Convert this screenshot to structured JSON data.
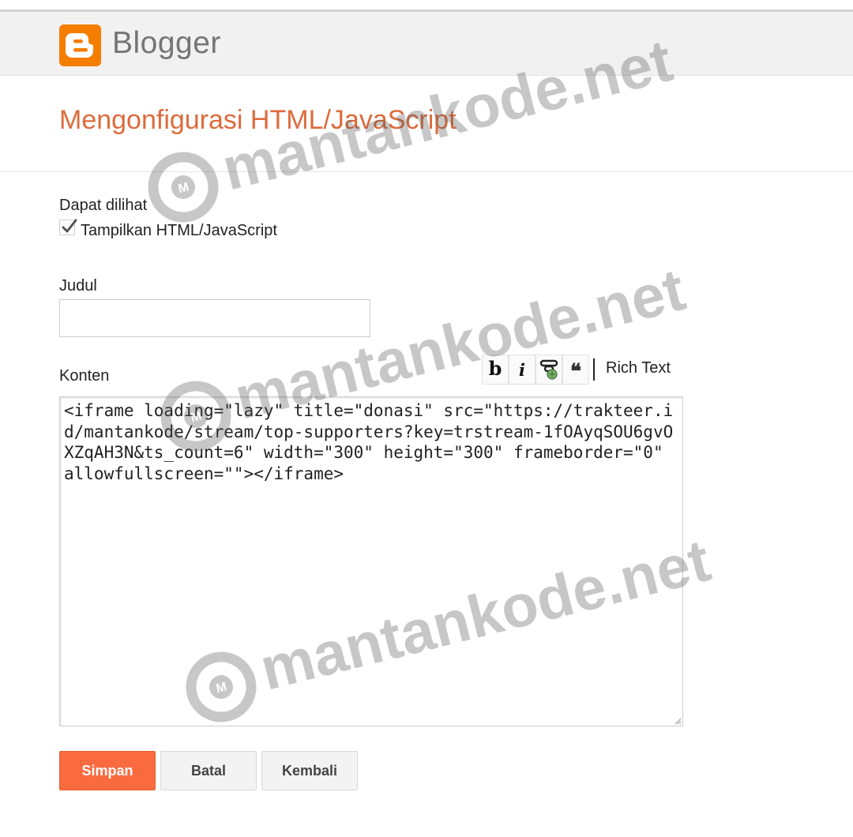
{
  "header": {
    "brand": "Blogger",
    "logo_icon": "blogger-logo-icon"
  },
  "page": {
    "title": "Mengonfigurasi HTML/JavaScript"
  },
  "visibility": {
    "label": "Dapat dilihat",
    "checkbox_label": "Tampilkan HTML/JavaScript",
    "checked": true
  },
  "judul": {
    "label": "Judul",
    "value": ""
  },
  "konten": {
    "label": "Konten",
    "toolbar": {
      "bold_label": "b",
      "italic_label": "i",
      "link_icon": "link-image-icon",
      "quote_label": "❝",
      "rich_text_label": "Rich Text"
    },
    "code": "<iframe loading=\"lazy\" title=\"donasi\" src=\"https://trakteer.id/mantankode/stream/top-supporters?key=trstream-1fOAyqSOU6gvOXZqAH3N&ts_count=6\" width=\"300\" height=\"300\" frameborder=\"0\" allowfullscreen=\"\"></iframe>"
  },
  "actions": {
    "save_label": "Simpan",
    "cancel_label": "Batal",
    "back_label": "Kembali"
  },
  "watermark": {
    "text": "mantankode.net",
    "badge_letter": "M"
  },
  "colors": {
    "accent_orange": "#f57d00",
    "title_orange": "#dd6b3d",
    "primary_button": "#f96b3f"
  }
}
